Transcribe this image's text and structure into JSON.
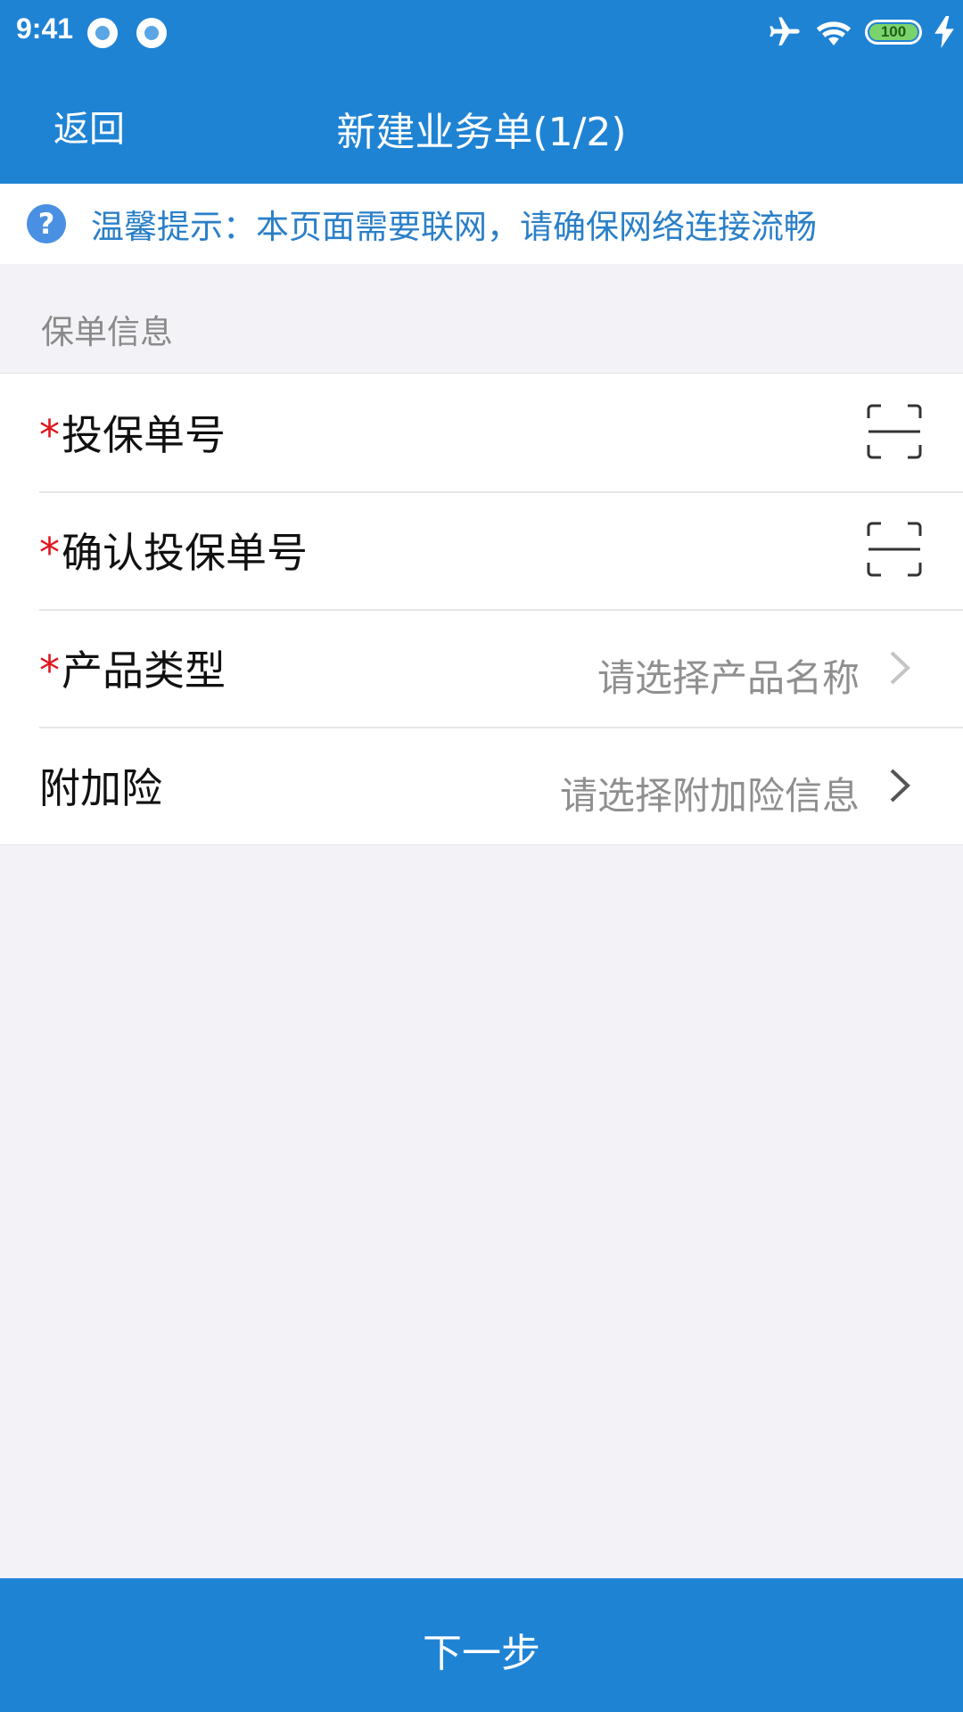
{
  "status_bar": {
    "time": "9:41",
    "battery": "100",
    "icons": [
      "notification-icon",
      "notification-icon",
      "airplane-icon",
      "wifi-icon",
      "battery-icon",
      "charging-icon"
    ]
  },
  "header": {
    "back_label": "返回",
    "title": "新建业务单(1/2)"
  },
  "tip": {
    "icon": "question-icon",
    "text": "温馨提示：本页面需要联网，请确保网络连接流畅"
  },
  "section": {
    "title": "保单信息"
  },
  "form": {
    "rows": [
      {
        "required": "*",
        "label": "投保单号",
        "action_icon": "scan-icon"
      },
      {
        "required": "*",
        "label": "确认投保单号",
        "action_icon": "scan-icon"
      },
      {
        "required": "*",
        "label": "产品类型",
        "placeholder": "请选择产品名称",
        "action_icon": "chevron-right-icon"
      },
      {
        "label": "附加险",
        "placeholder": "请选择附加险信息",
        "action_icon": "chevron-right-icon"
      }
    ]
  },
  "footer": {
    "next_label": "下一步"
  },
  "colors": {
    "primary": "#1f83d4",
    "tip_text": "#2a7fc8",
    "required": "#e0141e",
    "background": "#f3f3f7"
  }
}
